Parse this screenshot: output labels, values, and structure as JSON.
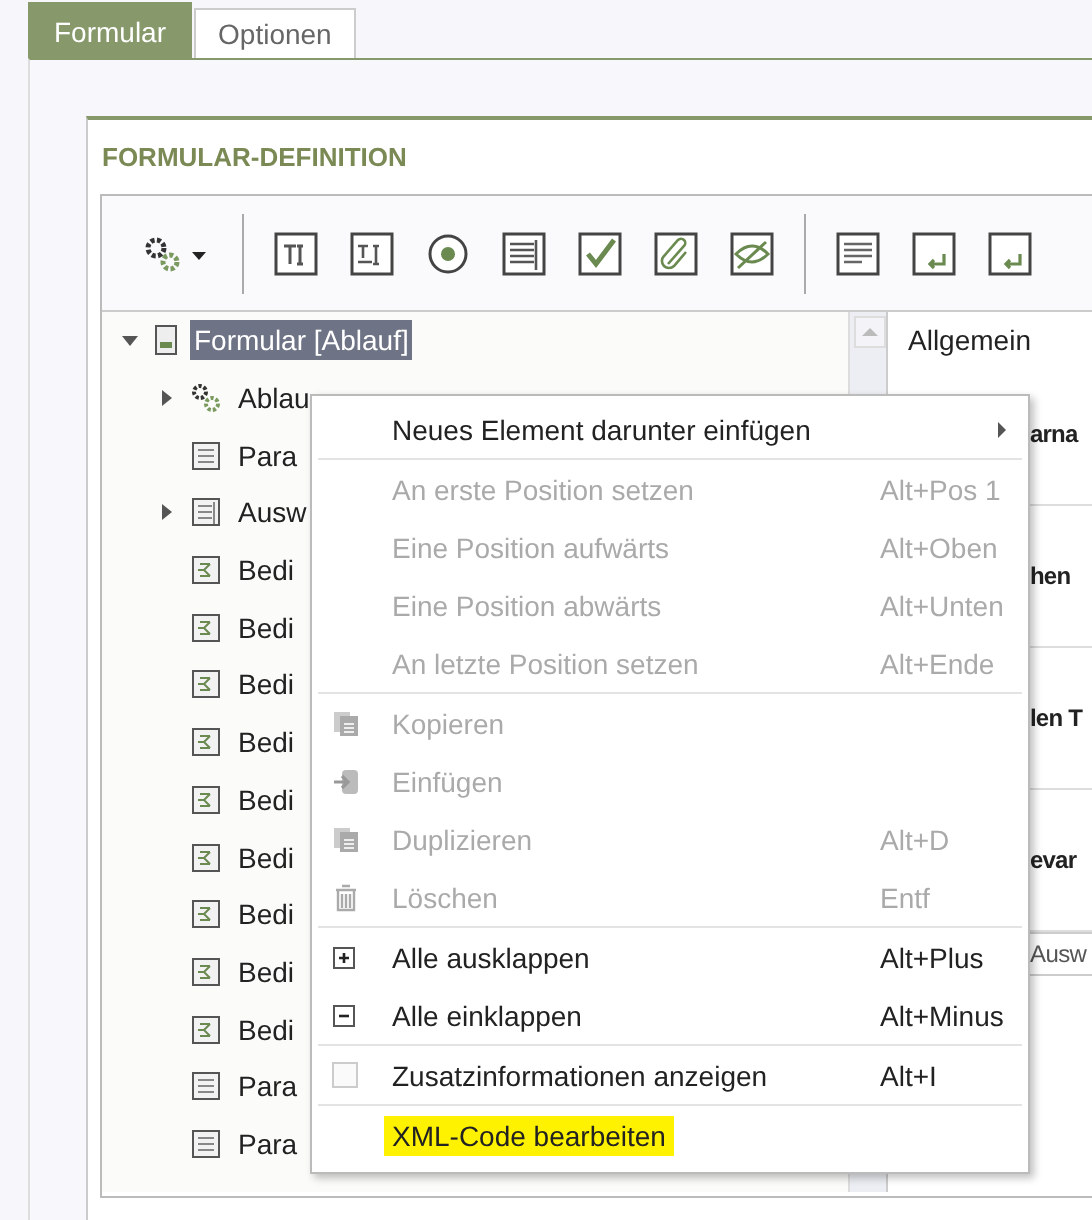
{
  "tabs": [
    {
      "label": "Formular",
      "selected": true
    },
    {
      "label": "Optionen",
      "selected": false
    }
  ],
  "panel": {
    "title": "FORMULAR-DEFINITION"
  },
  "toolbar": {
    "groups": [
      [
        {
          "kind": "gears"
        }
      ],
      [
        {
          "kind": "textfield"
        },
        {
          "kind": "textarea"
        },
        {
          "kind": "radio"
        },
        {
          "kind": "table"
        },
        {
          "kind": "checkbox"
        },
        {
          "kind": "attachment"
        },
        {
          "kind": "hidden"
        }
      ],
      [
        {
          "kind": "paragraph"
        },
        {
          "kind": "enter"
        },
        {
          "kind": "enter"
        }
      ]
    ]
  },
  "tree": [
    {
      "label": "Formular [Ablauf]",
      "kind": "form",
      "expanded": true,
      "selected": true,
      "children": [
        {
          "label": "Ablau",
          "kind": "gears",
          "expanded": false,
          "selected": false
        },
        {
          "label": "Para",
          "kind": "doc",
          "selected": false
        },
        {
          "label": "Ausw",
          "kind": "table",
          "expanded": false,
          "selected": false
        },
        {
          "label": "Bedi",
          "kind": "branch",
          "selected": false
        },
        {
          "label": "Bedi",
          "kind": "branch",
          "selected": false
        },
        {
          "label": "Bedi",
          "kind": "branch",
          "selected": false
        },
        {
          "label": "Bedi",
          "kind": "branch",
          "selected": false
        },
        {
          "label": "Bedi",
          "kind": "branch",
          "selected": false
        },
        {
          "label": "Bedi",
          "kind": "branch",
          "selected": false
        },
        {
          "label": "Bedi",
          "kind": "branch",
          "selected": false
        },
        {
          "label": "Bedi",
          "kind": "branch",
          "selected": false
        },
        {
          "label": "Bedi",
          "kind": "branch",
          "selected": false
        },
        {
          "label": "Para",
          "kind": "doc",
          "selected": false
        },
        {
          "label": "Para",
          "kind": "doc",
          "selected": false
        }
      ]
    }
  ],
  "details": {
    "tab": "Allgemein",
    "labels": [
      "arna",
      "hen",
      "len T",
      "evar"
    ],
    "field_value": "Ausw"
  },
  "context_menu": [
    [
      {
        "label": "Neues Element darunter einfügen",
        "disabled": false,
        "submenu": true,
        "highlighted": false
      }
    ],
    [
      {
        "label": "An erste Position setzen",
        "shortcut": "Alt+Pos 1",
        "disabled": true,
        "highlighted": false
      },
      {
        "label": "Eine Position aufwärts",
        "shortcut": "Alt+Oben",
        "disabled": true,
        "highlighted": false
      },
      {
        "label": "Eine Position abwärts",
        "shortcut": "Alt+Unten",
        "disabled": true,
        "highlighted": false
      },
      {
        "label": "An letzte Position setzen",
        "shortcut": "Alt+Ende",
        "disabled": true,
        "highlighted": false
      }
    ],
    [
      {
        "label": "Kopieren",
        "kind": "copy",
        "disabled": true,
        "highlighted": false
      },
      {
        "label": "Einfügen",
        "kind": "paste",
        "disabled": true,
        "highlighted": false
      },
      {
        "label": "Duplizieren",
        "kind": "copy",
        "shortcut": "Alt+D",
        "disabled": true,
        "highlighted": false
      },
      {
        "label": "Löschen",
        "kind": "trash",
        "shortcut": "Entf",
        "disabled": true,
        "highlighted": false
      }
    ],
    [
      {
        "label": "Alle ausklappen",
        "kind": "plus",
        "shortcut": "Alt+Plus",
        "disabled": false,
        "highlighted": false
      },
      {
        "label": "Alle einklappen",
        "kind": "minus",
        "shortcut": "Alt+Minus",
        "disabled": false,
        "highlighted": false
      }
    ],
    [
      {
        "label": "Zusatzinformationen anzeigen",
        "kind": "checkbox",
        "checked": false,
        "shortcut": "Alt+I",
        "disabled": false,
        "highlighted": false
      }
    ],
    [
      {
        "label": "XML-Code bearbeiten",
        "disabled": false,
        "highlighted": true
      }
    ]
  ]
}
